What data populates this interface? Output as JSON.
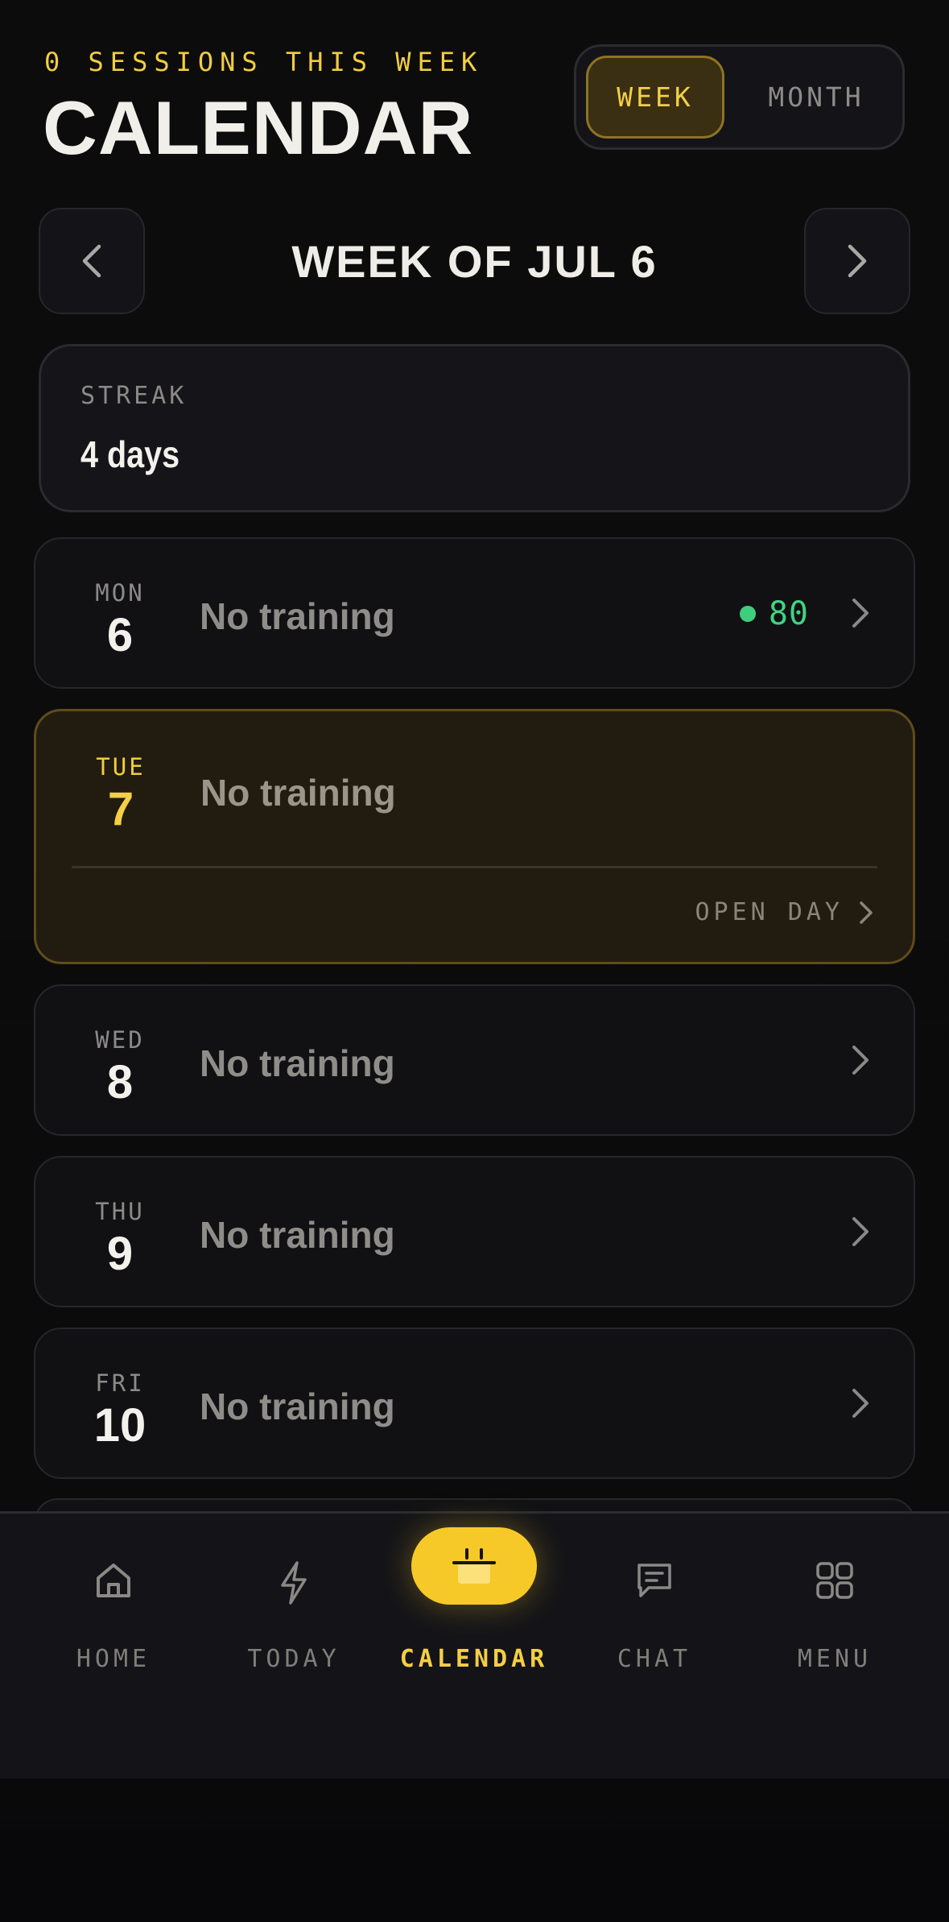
{
  "header": {
    "sessions_label": "0 SESSIONS THIS WEEK",
    "title": "CALENDAR",
    "view_toggle": {
      "week_label": "WEEK",
      "month_label": "MONTH",
      "selected": "WEEK"
    }
  },
  "week_nav": {
    "label": "WEEK OF JUL 6",
    "prev_icon": "chevron-left-icon",
    "next_icon": "chevron-right-icon"
  },
  "streak": {
    "label": "STREAK",
    "value": "4 days"
  },
  "days": [
    {
      "dow": "MON",
      "num": "6",
      "status": "No training",
      "score": "80"
    },
    {
      "dow": "TUE",
      "num": "7",
      "status": "No training",
      "today": true,
      "action": "OPEN DAY"
    },
    {
      "dow": "WED",
      "num": "8",
      "status": "No training"
    },
    {
      "dow": "THU",
      "num": "9",
      "status": "No training"
    },
    {
      "dow": "FRI",
      "num": "10",
      "status": "No training"
    }
  ],
  "tabs": [
    {
      "label": "HOME",
      "icon": "home-icon"
    },
    {
      "label": "TODAY",
      "icon": "lightning-icon"
    },
    {
      "label": "CALENDAR",
      "icon": "calendar-icon",
      "active": true
    },
    {
      "label": "CHAT",
      "icon": "chat-icon"
    },
    {
      "label": "MENU",
      "icon": "grid-icon"
    }
  ],
  "colors": {
    "accent": "#f4cf44",
    "score_green": "#40d383",
    "background": "#0a0a0b",
    "card": "#111114"
  }
}
